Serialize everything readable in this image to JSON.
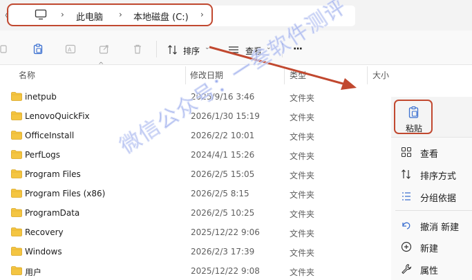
{
  "address_bar": {
    "path": [
      "此电脑",
      "本地磁盘 (C:)"
    ]
  },
  "toolbar": {
    "sort_label": "排序",
    "view_label": "查看",
    "more_label": "···"
  },
  "columns": {
    "name": "名称",
    "modified": "修改日期",
    "type": "类型",
    "size": "大小"
  },
  "files": [
    {
      "name": "inetpub",
      "date": "2025/9/16 3:46",
      "type": "文件夹"
    },
    {
      "name": "LenovoQuickFix",
      "date": "2026/1/30 15:19",
      "type": "文件夹"
    },
    {
      "name": "OfficeInstall",
      "date": "2026/2/2 10:01",
      "type": "文件夹"
    },
    {
      "name": "PerfLogs",
      "date": "2024/4/1 15:26",
      "type": "文件夹"
    },
    {
      "name": "Program Files",
      "date": "2026/2/5 15:05",
      "type": "文件夹"
    },
    {
      "name": "Program Files (x86)",
      "date": "2026/2/5 8:15",
      "type": "文件夹"
    },
    {
      "name": "ProgramData",
      "date": "2026/2/5 10:25",
      "type": "文件夹"
    },
    {
      "name": "Recovery",
      "date": "2025/12/22 9:06",
      "type": "文件夹"
    },
    {
      "name": "Windows",
      "date": "2026/2/3 17:39",
      "type": "文件夹"
    },
    {
      "name": "用户",
      "date": "2025/12/22 9:08",
      "type": "文件夹"
    }
  ],
  "context_menu": {
    "paste_label": "粘贴",
    "items": [
      "查看",
      "排序方式",
      "分组依据",
      "撤消 新建",
      "新建",
      "属性"
    ]
  },
  "watermark": "微信公众号：一叁软件测评"
}
